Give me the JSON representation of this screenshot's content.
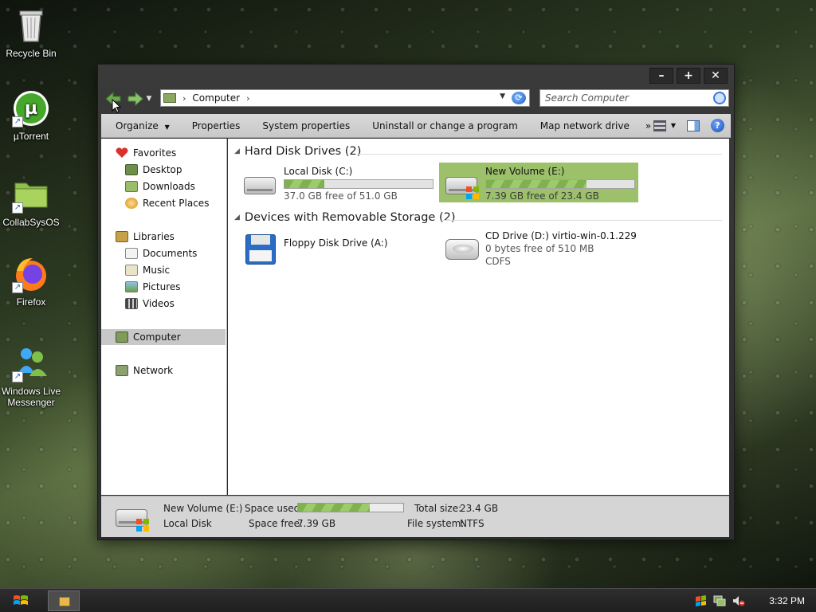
{
  "desktop": {
    "icons": [
      {
        "label": "Recycle Bin"
      },
      {
        "label": "µTorrent"
      },
      {
        "label": "CollabSysOS"
      },
      {
        "label": "Firefox"
      },
      {
        "label": "Windows Live Messenger"
      }
    ]
  },
  "window": {
    "controls": {
      "minimize": "–",
      "maximize": "+",
      "close": "✕"
    },
    "address": {
      "crumb": "Computer",
      "sep1": "›",
      "sep2": "›"
    },
    "search": {
      "placeholder": "Search Computer"
    },
    "toolbar": {
      "organize": "Organize",
      "properties": "Properties",
      "system_properties": "System properties",
      "uninstall": "Uninstall or change a program",
      "map_drive": "Map network drive",
      "more": "»"
    },
    "nav": {
      "favorites": "Favorites",
      "desktop": "Desktop",
      "downloads": "Downloads",
      "recent_places": "Recent Places",
      "libraries": "Libraries",
      "documents": "Documents",
      "music": "Music",
      "pictures": "Pictures",
      "videos": "Videos",
      "computer": "Computer",
      "network": "Network"
    },
    "groups": {
      "hdd": "Hard Disk Drives (2)",
      "removable": "Devices with Removable Storage (2)"
    },
    "drives": {
      "c": {
        "name": "Local Disk (C:)",
        "free": "37.0 GB free of 51.0 GB",
        "used_fraction": 0.27
      },
      "e": {
        "name": "New Volume (E:)",
        "free": "7.39 GB free of 23.4 GB",
        "used_fraction": 0.68
      },
      "a": {
        "name": "Floppy Disk Drive (A:)"
      },
      "d": {
        "name": "CD Drive (D:) virtio-win-0.1.229",
        "free": "0 bytes free of 510 MB",
        "fs": "CDFS"
      }
    },
    "details": {
      "name": "New Volume (E:)",
      "type": "Local Disk",
      "space_used_label": "Space used:",
      "space_free_label": "Space free:",
      "space_free": "7.39 GB",
      "total_label": "Total size:",
      "total": "23.4 GB",
      "fs_label": "File system:",
      "fs": "NTFS",
      "used_fraction": 0.68
    }
  },
  "taskbar": {
    "clock": "3:32 PM"
  },
  "colors": {
    "selection_green": "#9cc16a",
    "bar_green": "#7fb24f"
  }
}
